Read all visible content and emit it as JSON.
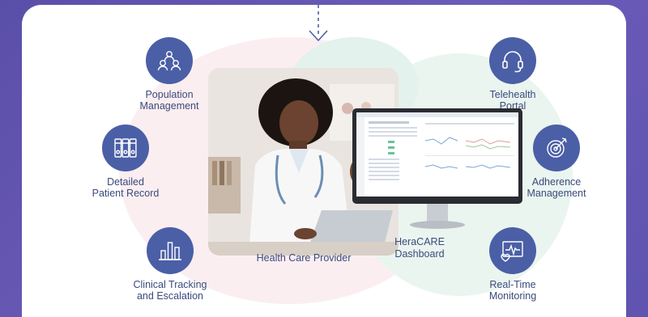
{
  "nodes": {
    "population": "Population\nManagement",
    "patient_record": "Detailed\nPatient Record",
    "clinical": "Clinical Tracking\nand Escalation",
    "telehealth": "Telehealth\nPortal",
    "adherence": "Adherence\nManagement",
    "monitoring": "Real-Time\nMonitoring"
  },
  "captions": {
    "provider": "Health Care Provider",
    "dashboard": "HeraCARE\nDashboard"
  },
  "colors": {
    "icon_circle": "#4b5fa6",
    "label_text": "#3a4a7c",
    "background": "#5a4fa8"
  }
}
